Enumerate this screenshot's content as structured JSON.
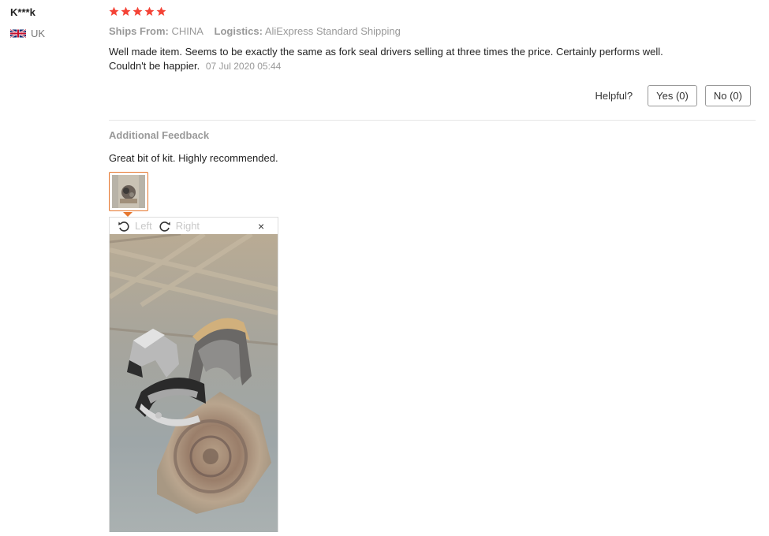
{
  "reviewer": {
    "name": "K***k",
    "country": "UK"
  },
  "review": {
    "rating": 5,
    "star_color": "#f44336",
    "ships_from_label": "Ships From:",
    "ships_from_value": "CHINA",
    "logistics_label": "Logistics:",
    "logistics_value": "AliExpress Standard Shipping",
    "text": "Well made item. Seems to be exactly the same as fork seal drivers selling at three times the price. Certainly performs well. Couldn't be happier.",
    "date": "07 Jul 2020 05:44"
  },
  "helpful": {
    "label": "Helpful?",
    "yes": "Yes (0)",
    "no": "No (0)"
  },
  "additional": {
    "title": "Additional Feedback",
    "text": "Great bit of kit. Highly recommended."
  },
  "viewer": {
    "rotate_left": "Left",
    "rotate_right": "Right",
    "close": "×"
  },
  "colors": {
    "accent": "#e6772e",
    "muted": "#999999"
  }
}
